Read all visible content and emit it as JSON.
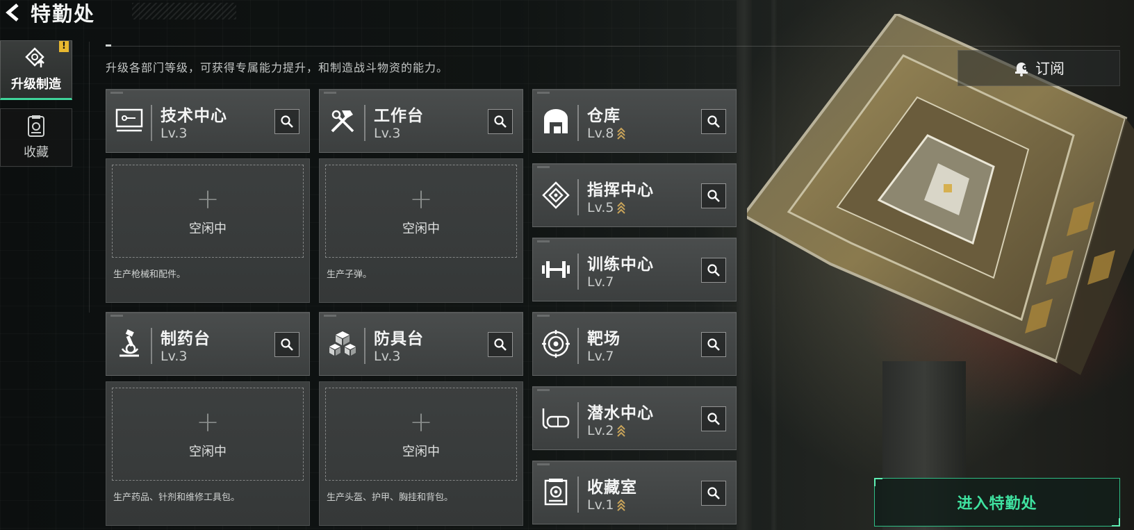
{
  "header": {
    "title": "特勤处"
  },
  "sidebar": {
    "items": [
      {
        "label": "升级制造",
        "icon": "upgrade-icon",
        "active": true,
        "badge": "!"
      },
      {
        "label": "收藏",
        "icon": "collection-icon",
        "active": false
      }
    ]
  },
  "description": "升级各部门等级，可获得专属能力提升，和制造战斗物资的能力。",
  "subscribe": {
    "label": "订阅",
    "icon": "bell-icon"
  },
  "facilities": [
    {
      "name": "技术中心",
      "level": "Lv.3",
      "icon": "tech-center-icon",
      "upgradable": false
    },
    {
      "name": "工作台",
      "level": "Lv.3",
      "icon": "workbench-icon",
      "upgradable": false
    },
    {
      "name": "仓库",
      "level": "Lv.8",
      "icon": "warehouse-icon",
      "upgradable": true
    },
    {
      "name": "指挥中心",
      "level": "Lv.5",
      "icon": "command-center-icon",
      "upgradable": true
    },
    {
      "name": "训练中心",
      "level": "Lv.7",
      "icon": "training-center-icon",
      "upgradable": false
    },
    {
      "name": "制药台",
      "level": "Lv.3",
      "icon": "pharmacy-icon",
      "upgradable": false
    },
    {
      "name": "防具台",
      "level": "Lv.3",
      "icon": "armor-bench-icon",
      "upgradable": false
    },
    {
      "name": "靶场",
      "level": "Lv.7",
      "icon": "shooting-range-icon",
      "upgradable": false
    },
    {
      "name": "潜水中心",
      "level": "Lv.2",
      "icon": "diving-center-icon",
      "upgradable": true
    },
    {
      "name": "收藏室",
      "level": "Lv.1",
      "icon": "collection-room-icon",
      "upgradable": true
    }
  ],
  "production_slots": [
    {
      "status": "空闲中",
      "description": "生产枪械和配件。"
    },
    {
      "status": "空闲中",
      "description": "生产子弹。"
    },
    {
      "status": "空闲中",
      "description": "生产药品、针剂和维修工具包。"
    },
    {
      "status": "空闲中",
      "description": "生产头盔、护甲、胸挂和背包。"
    }
  ],
  "enter_button": {
    "label": "进入特勤处"
  },
  "colors": {
    "accent": "#3fe2a0",
    "badge": "#e8b830",
    "upgrade_arrow": "#c9a45a"
  }
}
